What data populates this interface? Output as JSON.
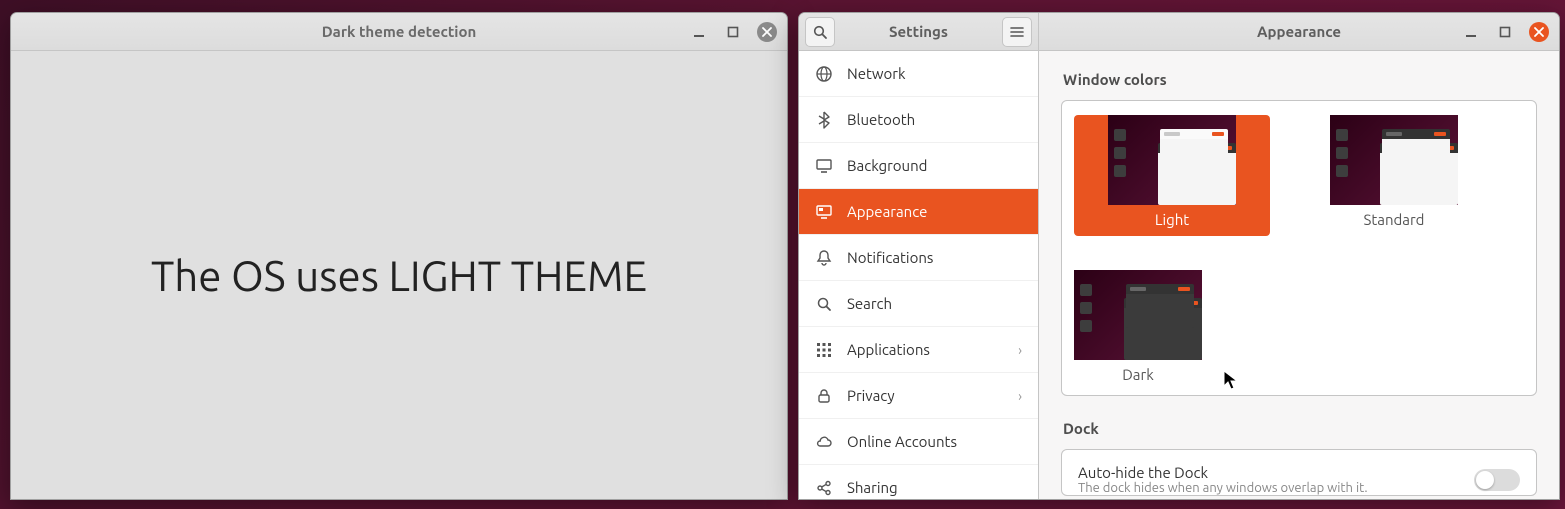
{
  "demo_window": {
    "title": "Dark theme detection",
    "message": "The OS uses LIGHT THEME"
  },
  "settings_window": {
    "sidebar_title": "Settings",
    "content_title": "Appearance",
    "sidebar": {
      "items": [
        {
          "id": "network",
          "label": "Network",
          "icon": "globe",
          "has_children": false
        },
        {
          "id": "bluetooth",
          "label": "Bluetooth",
          "icon": "bluetooth",
          "has_children": false
        },
        {
          "id": "background",
          "label": "Background",
          "icon": "monitor",
          "has_children": false
        },
        {
          "id": "appearance",
          "label": "Appearance",
          "icon": "appearance",
          "has_children": false,
          "selected": true
        },
        {
          "id": "notifications",
          "label": "Notifications",
          "icon": "bell",
          "has_children": false
        },
        {
          "id": "search",
          "label": "Search",
          "icon": "search",
          "has_children": false
        },
        {
          "id": "applications",
          "label": "Applications",
          "icon": "apps",
          "has_children": true
        },
        {
          "id": "privacy",
          "label": "Privacy",
          "icon": "lock",
          "has_children": true
        },
        {
          "id": "online_accounts",
          "label": "Online Accounts",
          "icon": "cloud",
          "has_children": false
        },
        {
          "id": "sharing",
          "label": "Sharing",
          "icon": "share",
          "has_children": false
        }
      ]
    },
    "appearance": {
      "window_colors_label": "Window colors",
      "themes": [
        {
          "id": "light",
          "label": "Light",
          "selected": true
        },
        {
          "id": "standard",
          "label": "Standard",
          "selected": false
        },
        {
          "id": "dark",
          "label": "Dark",
          "selected": false
        }
      ],
      "dock_label": "Dock",
      "autohide_label": "Auto-hide the Dock",
      "autohide_sub": "The dock hides when any windows overlap with it.",
      "autohide_enabled": false
    }
  },
  "accent_color": "#E95420"
}
